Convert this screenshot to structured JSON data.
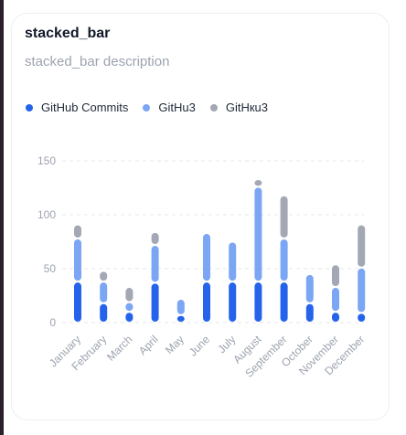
{
  "card": {
    "title": "stacked_bar",
    "subtitle": "stacked_bar description"
  },
  "colors": {
    "series": [
      "#2563eb",
      "#7ba6f4",
      "#a3a8b4"
    ],
    "grid": "#e5e7eb",
    "tick": "#9ca3af"
  },
  "chart_data": {
    "type": "bar",
    "stacked": true,
    "categories": [
      "January",
      "February",
      "March",
      "April",
      "May",
      "June",
      "July",
      "August",
      "September",
      "October",
      "November",
      "December"
    ],
    "series": [
      {
        "name": "GitHub Commits",
        "values": [
          38,
          18,
          10,
          37,
          7,
          38,
          38,
          38,
          38,
          18,
          10,
          9
        ]
      },
      {
        "name": "GitHu3",
        "values": [
          40,
          20,
          9,
          35,
          15,
          45,
          37,
          88,
          40,
          27,
          23,
          42
        ]
      },
      {
        "name": "GitHкu3",
        "values": [
          13,
          10,
          14,
          12,
          0,
          0,
          0,
          7,
          40,
          0,
          21,
          40
        ]
      }
    ],
    "y_ticks": [
      0,
      50,
      100,
      150
    ],
    "ylim": [
      0,
      150
    ],
    "grid": true,
    "legend_position": "top-left"
  }
}
